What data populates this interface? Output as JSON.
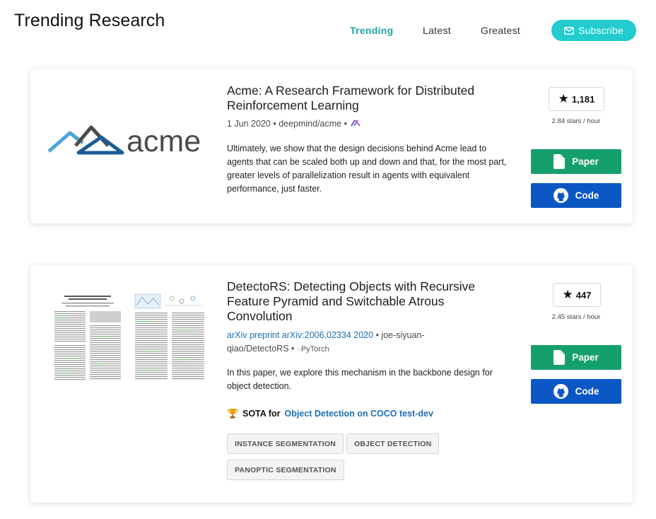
{
  "header": {
    "title": "Trending Research",
    "nav": [
      {
        "label": "Trending",
        "active": true
      },
      {
        "label": "Latest",
        "active": false
      },
      {
        "label": "Greatest",
        "active": false
      }
    ],
    "subscribe_label": "Subscribe"
  },
  "papers": [
    {
      "logo_text": "acme",
      "title": "Acme: A Research Framework for Distributed Reinforcement Learning",
      "date": "1 Jun 2020",
      "repo": "deepmind/acme",
      "framework_icon": "jax-icon",
      "abstract": "Ultimately, we show that the design decisions behind Acme lead to agents that can be scaled both up and down and that, for the most part, greater levels of parallelization result in agents with equivalent performance, just faster.",
      "stars": "1,181",
      "stars_rate": "2.84 stars / hour",
      "paper_label": "Paper",
      "code_label": "Code"
    },
    {
      "title": "DetectoRS: Detecting Objects with Recursive Feature Pyramid and Switchable Atrous Convolution",
      "source": "arXiv preprint arXiv:2006.02334 2020",
      "repo_line1": "joe-siyuan-",
      "repo_line2": "qiao/DetectoRS",
      "framework": "PyTorch",
      "abstract": "In this paper, we explore this mechanism in the backbone design for object detection.",
      "sota_prefix": "SOTA for",
      "sota_task": "Object Detection on COCO test-dev",
      "tags": [
        "INSTANCE SEGMENTATION",
        "OBJECT DETECTION",
        "PANOPTIC SEGMENTATION"
      ],
      "stars": "447",
      "stars_rate": "2.45 stars / hour",
      "paper_label": "Paper",
      "code_label": "Code"
    }
  ],
  "colors": {
    "accent": "#21cbce",
    "nav_active": "#21a3a3",
    "paper_button": "#15a06b",
    "code_button": "#0b57c4",
    "link": "#1f6fb2"
  }
}
